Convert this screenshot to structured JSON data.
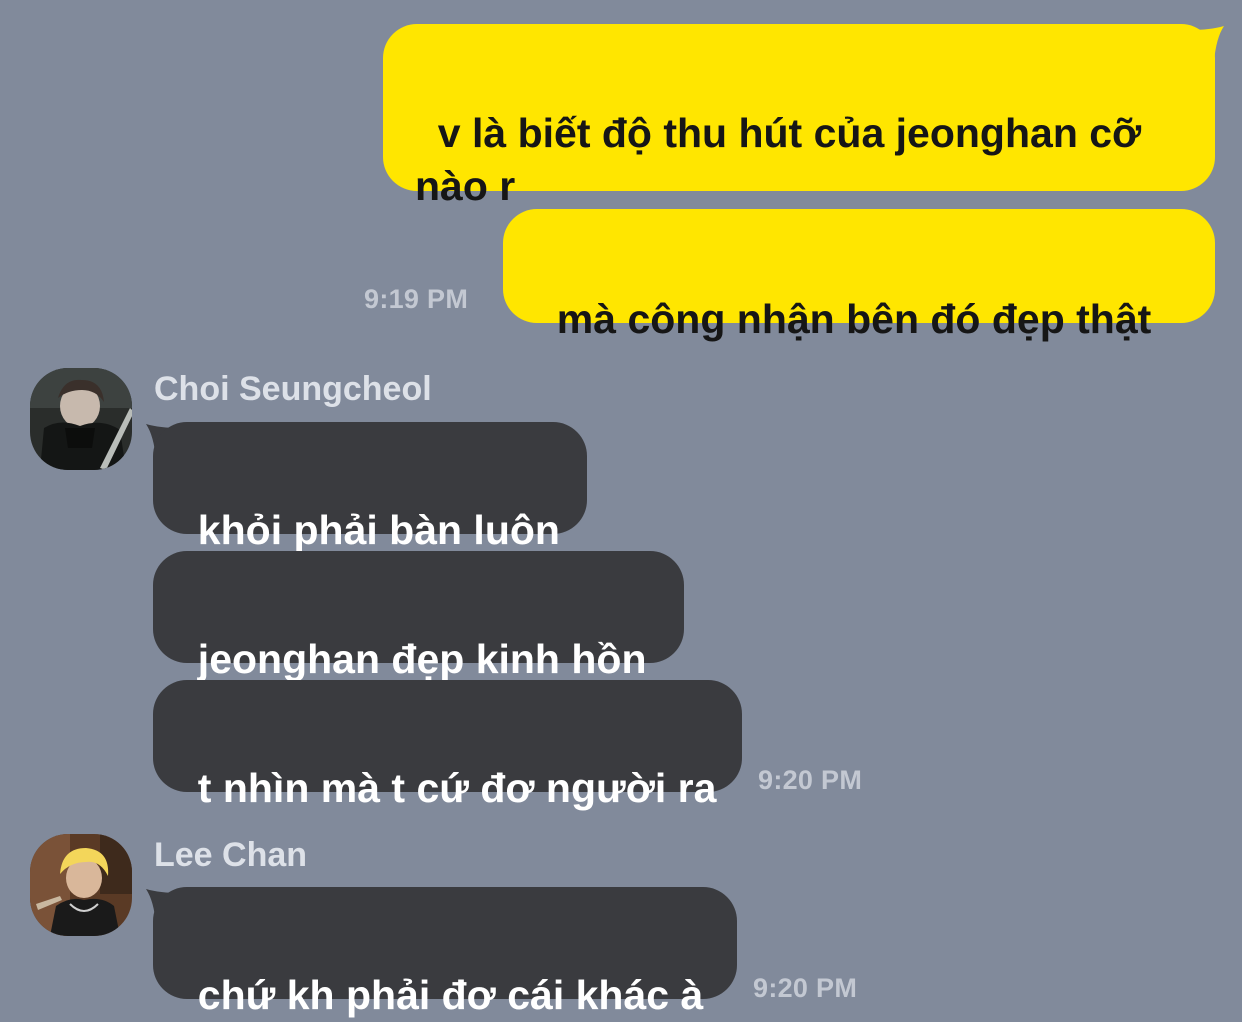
{
  "messages": [
    {
      "direction": "outgoing",
      "text": "v là biết độ thu hút của jeonghan cỡ nào r"
    },
    {
      "direction": "outgoing",
      "text": "mà công nhận bên đó đẹp thật",
      "time": "9:19 PM"
    },
    {
      "direction": "incoming",
      "sender": "Choi Seungcheol",
      "text": "khỏi phải bàn luôn"
    },
    {
      "direction": "incoming",
      "sender": "Choi Seungcheol",
      "text": "jeonghan đẹp kinh hồn"
    },
    {
      "direction": "incoming",
      "sender": "Choi Seungcheol",
      "text": "t nhìn mà t cứ đơ người ra",
      "time": "9:20 PM"
    },
    {
      "direction": "incoming",
      "sender": "Lee Chan",
      "text": "chứ kh phải đơ cái khác à",
      "time": "9:20 PM"
    }
  ],
  "groups": [
    {
      "sender": "Choi Seungcheol",
      "avatar": "profile-photo"
    },
    {
      "sender": "Lee Chan",
      "avatar": "profile-photo"
    }
  ],
  "colors": {
    "background": "#818a9b",
    "outgoing_bubble": "#ffe600",
    "incoming_bubble": "#3a3b3f"
  }
}
